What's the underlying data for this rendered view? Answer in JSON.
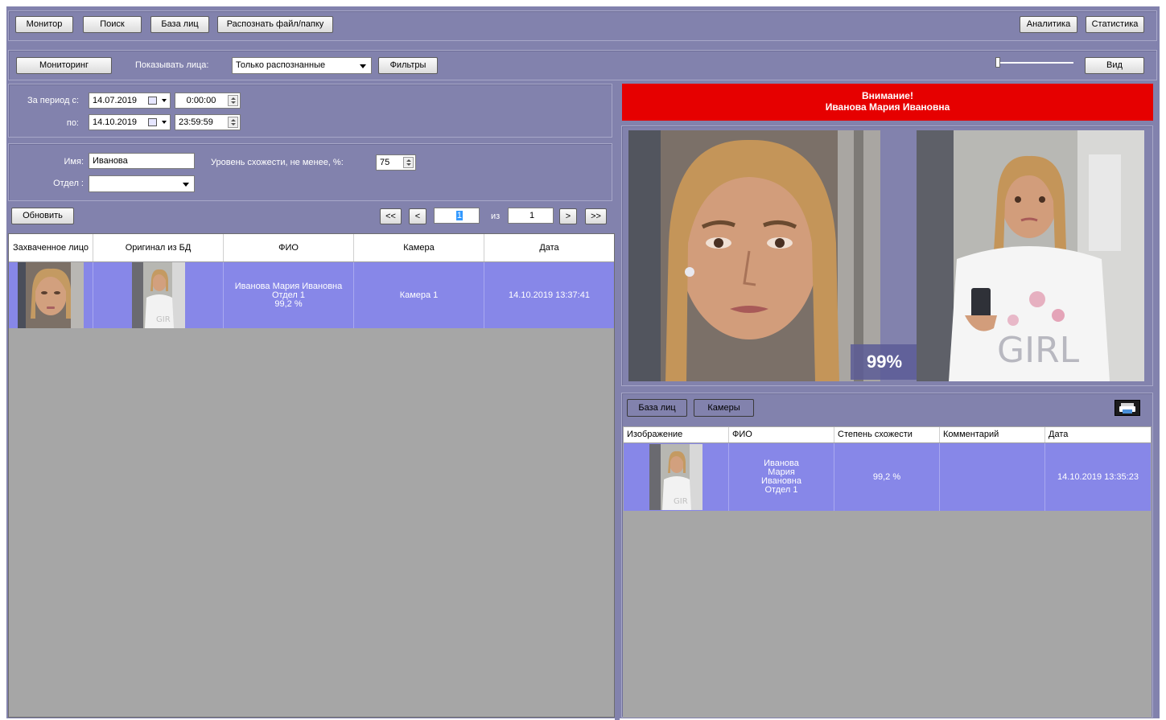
{
  "toolbar": {
    "monitor": "Монитор",
    "search": "Поиск",
    "face_db": "База лиц",
    "recognize": "Распознать файл/папку",
    "analytics": "Аналитика",
    "statistics": "Статистика"
  },
  "subbar": {
    "monitoring": "Мониторинг",
    "show_faces_label": "Показывать лица:",
    "show_faces_value": "Только распознанные",
    "filters": "Фильтры",
    "view": "Вид",
    "zoom_level": 0.0
  },
  "period": {
    "from_label": "За период с:",
    "to_label": "по:",
    "from_date": "14.07.2019",
    "from_time": "0:00:00",
    "to_date": "14.10.2019",
    "to_time": "23:59:59"
  },
  "filter": {
    "name_label": "Имя:",
    "name_value": "Иванова",
    "similarity_label": "Уровень схожести, не менее, %:",
    "similarity_value": "75",
    "dept_label": "Отдел :",
    "dept_value": ""
  },
  "pager": {
    "refresh": "Обновить",
    "first": "<<",
    "prev": "<",
    "page": "1",
    "of": "из",
    "total": "1",
    "next": ">",
    "last": ">>"
  },
  "results": {
    "columns": [
      "Захваченное лицо",
      "Оригинал из БД",
      "ФИО",
      "Камера",
      "Дата"
    ],
    "rows": [
      {
        "name": "Иванова Мария Ивановна",
        "dept": "Отдел 1",
        "score": "99,2 %",
        "camera": "Камера 1",
        "date": "14.10.2019 13:37:41"
      }
    ]
  },
  "alert": {
    "line1": "Внимание!",
    "line2": "Иванова Мария Ивановна"
  },
  "compare": {
    "percent": "99%",
    "photo_text": "GIRL"
  },
  "lower": {
    "tab_db": "База лиц",
    "tab_cameras": "Камеры",
    "columns": [
      "Изображение",
      "ФИО",
      "Степень схожести",
      "Комментарий",
      "Дата"
    ],
    "rows": [
      {
        "name_l1": "Иванова",
        "name_l2": "Мария",
        "name_l3": "Ивановна",
        "name_l4": "Отдел 1",
        "score": "99,2 %",
        "comment": "",
        "date": "14.10.2019 13:35:23"
      }
    ]
  },
  "colors": {
    "panel": "#8282ad",
    "row_selected": "#8787e8",
    "alert": "#e60000"
  }
}
